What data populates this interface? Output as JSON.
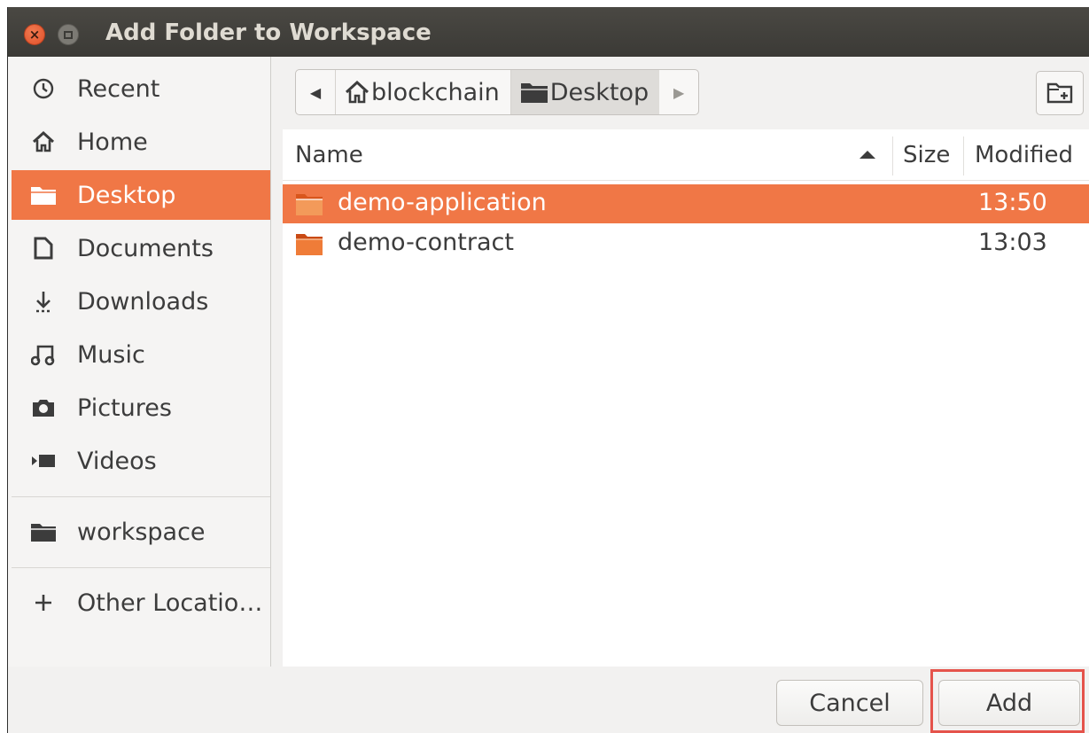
{
  "window": {
    "title": "Add Folder to Workspace"
  },
  "sidebar": {
    "items": [
      {
        "label": "Recent",
        "icon": "clock-icon"
      },
      {
        "label": "Home",
        "icon": "home-icon"
      },
      {
        "label": "Desktop",
        "icon": "folder-icon",
        "active": true
      },
      {
        "label": "Documents",
        "icon": "document-icon"
      },
      {
        "label": "Downloads",
        "icon": "download-icon"
      },
      {
        "label": "Music",
        "icon": "music-icon"
      },
      {
        "label": "Pictures",
        "icon": "camera-icon"
      },
      {
        "label": "Videos",
        "icon": "video-icon"
      }
    ],
    "bookmarks": [
      {
        "label": "workspace",
        "icon": "folder-icon"
      }
    ],
    "other": {
      "label": "Other Locatio…",
      "icon": "plus-icon"
    }
  },
  "pathbar": {
    "crumbs": [
      {
        "label": "blockchain",
        "icon": "home-icon"
      },
      {
        "label": "Desktop",
        "icon": "folder-icon",
        "current": true
      }
    ]
  },
  "filelist": {
    "columns": {
      "name": "Name",
      "size": "Size",
      "modified": "Modified"
    },
    "sort": "name-ascending",
    "rows": [
      {
        "name": "demo-application",
        "size": "",
        "modified": "13:50",
        "selected": true
      },
      {
        "name": "demo-contract",
        "size": "",
        "modified": "13:03",
        "selected": false
      }
    ]
  },
  "footer": {
    "cancel_label": "Cancel",
    "add_label": "Add"
  },
  "colors": {
    "accent": "#f07746",
    "titlebar": "#3b3a36",
    "highlight_box": "#e5534b"
  }
}
